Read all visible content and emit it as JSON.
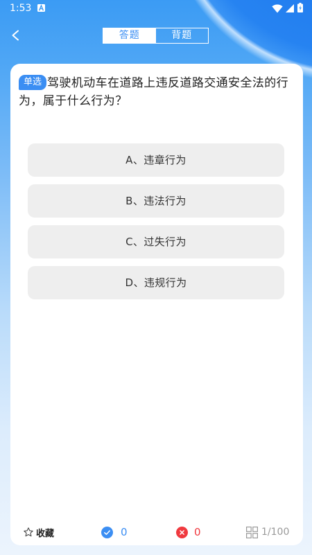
{
  "status_bar": {
    "time": "1:53",
    "left_icons": [
      "a-notification-icon"
    ],
    "right_icons": [
      "wifi-icon",
      "cell-signal-icon",
      "battery-charging-icon"
    ]
  },
  "header": {
    "back_icon": "chevron-left-icon",
    "tabs": [
      {
        "label": "答题",
        "selected": true
      },
      {
        "label": "背题",
        "selected": false
      }
    ]
  },
  "question": {
    "type_badge": "单选",
    "text": "驾驶机动车在道路上违反道路交通安全法的行为，属于什么行为？",
    "options": [
      {
        "label": "A、违章行为"
      },
      {
        "label": "B、违法行为"
      },
      {
        "label": "C、过失行为"
      },
      {
        "label": "D、违规行为"
      }
    ]
  },
  "footer": {
    "favorite_icon": "star-outline-icon",
    "favorite_label": "收藏",
    "correct_icon": "check-circle-icon",
    "correct_count": "0",
    "wrong_icon": "x-circle-icon",
    "wrong_count": "0",
    "progress_icon": "grid-icon",
    "progress": "1/100"
  },
  "colors": {
    "accent": "#3b8ef3",
    "correct": "#3b8ef3",
    "wrong": "#f0393f",
    "option_bg": "#eeeeee",
    "muted_text": "#999999"
  }
}
